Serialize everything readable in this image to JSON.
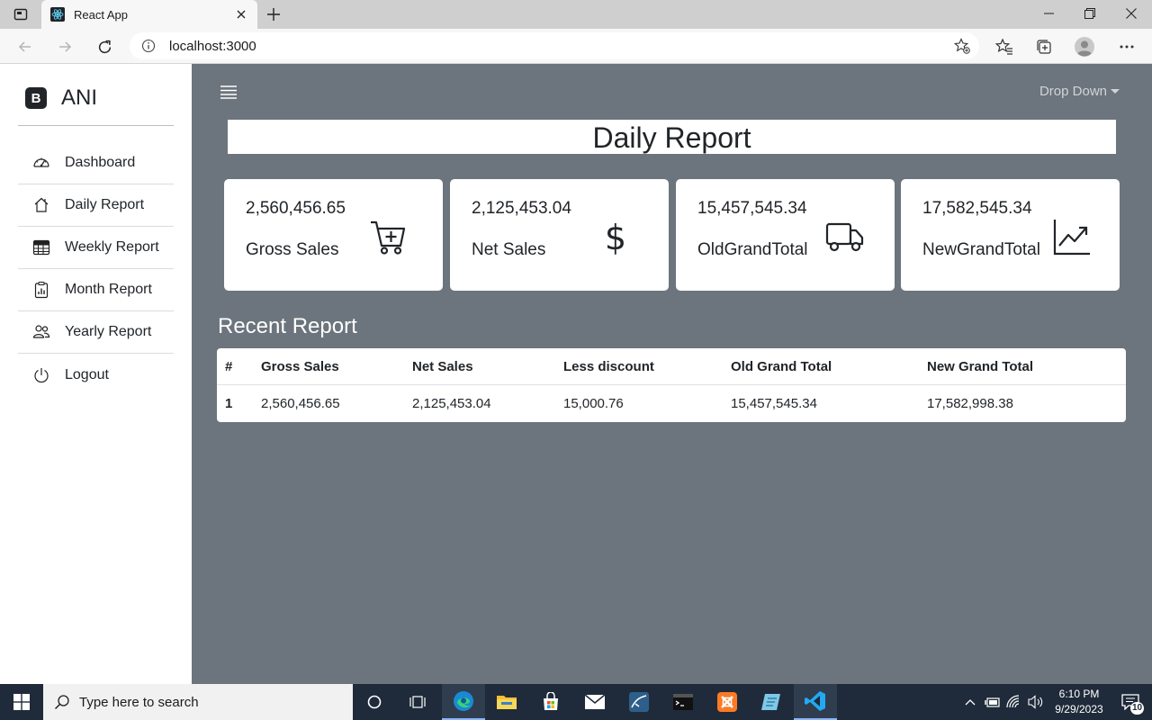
{
  "browser": {
    "tab_title": "React App",
    "url": "localhost:3000"
  },
  "sidebar": {
    "brand_letter": "B",
    "brand_name": "ANI",
    "items": [
      {
        "label": "Dashboard",
        "icon": "speedometer-icon"
      },
      {
        "label": "Daily Report",
        "icon": "house-icon"
      },
      {
        "label": "Weekly Report",
        "icon": "table-icon"
      },
      {
        "label": "Month Report",
        "icon": "clipboard-chart-icon"
      },
      {
        "label": "Yearly Report",
        "icon": "people-icon"
      },
      {
        "label": "Logout",
        "icon": "power-icon"
      }
    ]
  },
  "header": {
    "dropdown_label": "Drop Down"
  },
  "page": {
    "title": "Daily Report"
  },
  "cards": [
    {
      "value": "2,560,456.65",
      "label": "Gross Sales",
      "icon": "cart-plus-icon"
    },
    {
      "value": "2,125,453.04",
      "label": "Net Sales",
      "icon": "dollar-icon"
    },
    {
      "value": "15,457,545.34",
      "label": "OldGrandTotal",
      "icon": "truck-icon"
    },
    {
      "value": "17,582,545.34",
      "label": "NewGrandTotal",
      "icon": "graph-up-icon"
    }
  ],
  "recent": {
    "title": "Recent Report",
    "columns": [
      "#",
      "Gross Sales",
      "Net Sales",
      "Less discount",
      "Old Grand Total",
      "New Grand Total"
    ],
    "rows": [
      [
        "1",
        "2,560,456.65",
        "2,125,453.04",
        "15,000.76",
        "15,457,545.34",
        "17,582,998.38"
      ]
    ]
  },
  "taskbar": {
    "search_placeholder": "Type here to search",
    "time": "6:10 PM",
    "date": "9/29/2023",
    "notification_count": "10"
  }
}
